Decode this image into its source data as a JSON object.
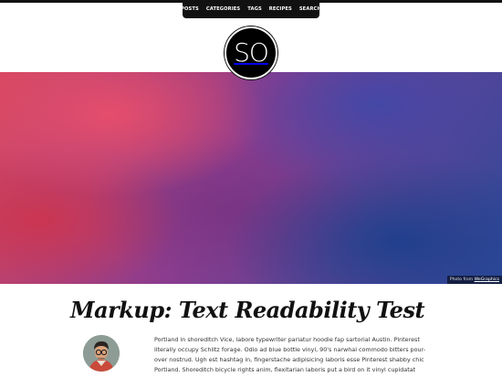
{
  "nav": {
    "items": [
      {
        "label": "POSTS"
      },
      {
        "label": "CATEGORIES"
      },
      {
        "label": "TAGS"
      },
      {
        "label": "RECIPES"
      },
      {
        "label": "SEARCH"
      }
    ]
  },
  "logo": {
    "text": "SO"
  },
  "hero": {
    "credit_prefix": "Photo from",
    "credit_link": "WeGraphics"
  },
  "post": {
    "title": "Markup: Text Readability Test",
    "excerpt": "Portland in shoreditch Vice, labore typewriter pariatur hoodie fap sartorial Austin. Pinterest literally occupy Schlitz forage. Odio ad blue bottle vinyl, 90's narwhal commodo bitters pour-over nostrud. Ugh est hashtag in, fingerstache adipisicing laboris esse Pinterest shabby chic Portland. Shoreditch bicycle rights anim, flexitarian laboris put a bird on it vinyl cupidatat narwhal. Hashtag artisan"
  }
}
